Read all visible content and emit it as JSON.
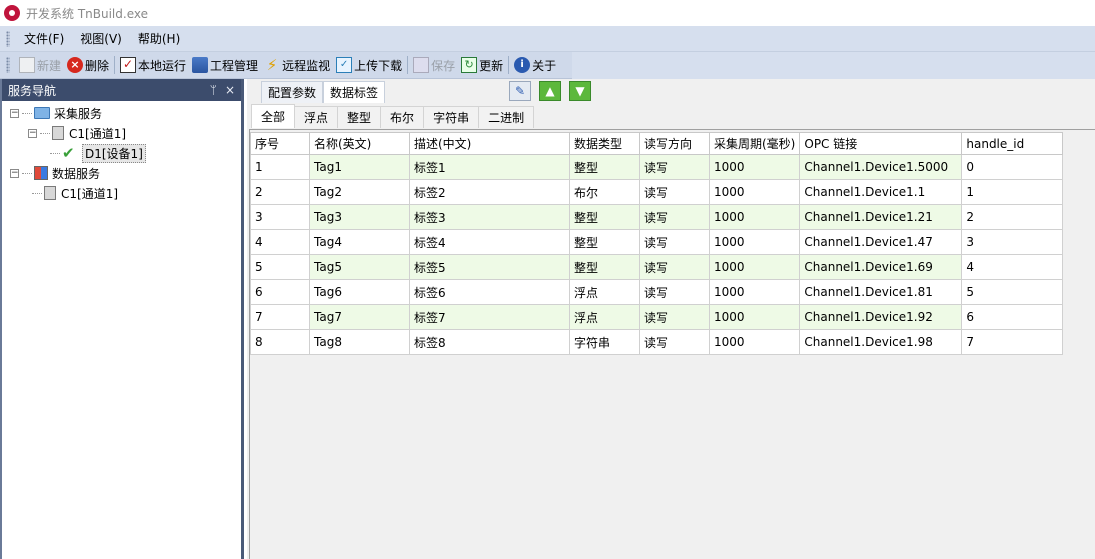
{
  "window": {
    "title": "开发系统 TnBuild.exe"
  },
  "menu": [
    "文件(F)",
    "视图(V)",
    "帮助(H)"
  ],
  "toolbar": [
    {
      "label": "新建",
      "icon": "new-icon",
      "enabled": false
    },
    {
      "label": "删除",
      "icon": "delete-icon",
      "enabled": true
    },
    {
      "label": "本地运行",
      "icon": "run-local-icon",
      "enabled": true
    },
    {
      "label": "工程管理",
      "icon": "project-icon",
      "enabled": true
    },
    {
      "label": "远程监视",
      "icon": "lightning-icon",
      "enabled": true
    },
    {
      "label": "上传下载",
      "icon": "upload-icon",
      "enabled": true
    },
    {
      "label": "保存",
      "icon": "save-icon",
      "enabled": false
    },
    {
      "label": "更新",
      "icon": "refresh-icon",
      "enabled": true
    },
    {
      "label": "关于",
      "icon": "about-icon",
      "enabled": true
    }
  ],
  "nav": {
    "title": "服务导航",
    "pin": "ᛘ",
    "close": "×",
    "tree": [
      {
        "label": "采集服务",
        "expander": "−"
      },
      {
        "label": "C1[通道1]",
        "expander": "−"
      },
      {
        "label": "D1[设备1]"
      },
      {
        "label": "数据服务",
        "expander": "−"
      },
      {
        "label": "C1[通道1]"
      }
    ]
  },
  "main": {
    "top_tabs": [
      "配置参数",
      "数据标签"
    ],
    "active_top_tab": 1,
    "sub_tabs": [
      "全部",
      "浮点",
      "整型",
      "布尔",
      "字符串",
      "二进制"
    ],
    "active_sub_tab": 0,
    "columns": [
      "序号",
      "名称(英文)",
      "描述(中文)",
      "数据类型",
      "读写方向",
      "采集周期(毫秒)",
      "OPC 链接",
      "handle_id"
    ],
    "rows": [
      [
        "1",
        "Tag1",
        "标签1",
        "整型",
        "读写",
        "1000",
        "Channel1.Device1.5000",
        "0"
      ],
      [
        "2",
        "Tag2",
        "标签2",
        "布尔",
        "读写",
        "1000",
        "Channel1.Device1.1",
        "1"
      ],
      [
        "3",
        "Tag3",
        "标签3",
        "整型",
        "读写",
        "1000",
        "Channel1.Device1.21",
        "2"
      ],
      [
        "4",
        "Tag4",
        "标签4",
        "整型",
        "读写",
        "1000",
        "Channel1.Device1.47",
        "3"
      ],
      [
        "5",
        "Tag5",
        "标签5",
        "整型",
        "读写",
        "1000",
        "Channel1.Device1.69",
        "4"
      ],
      [
        "6",
        "Tag6",
        "标签6",
        "浮点",
        "读写",
        "1000",
        "Channel1.Device1.81",
        "5"
      ],
      [
        "7",
        "Tag7",
        "标签7",
        "浮点",
        "读写",
        "1000",
        "Channel1.Device1.92",
        "6"
      ],
      [
        "8",
        "Tag8",
        "标签8",
        "字符串",
        "读写",
        "1000",
        "Channel1.Device1.98",
        "7"
      ]
    ]
  }
}
